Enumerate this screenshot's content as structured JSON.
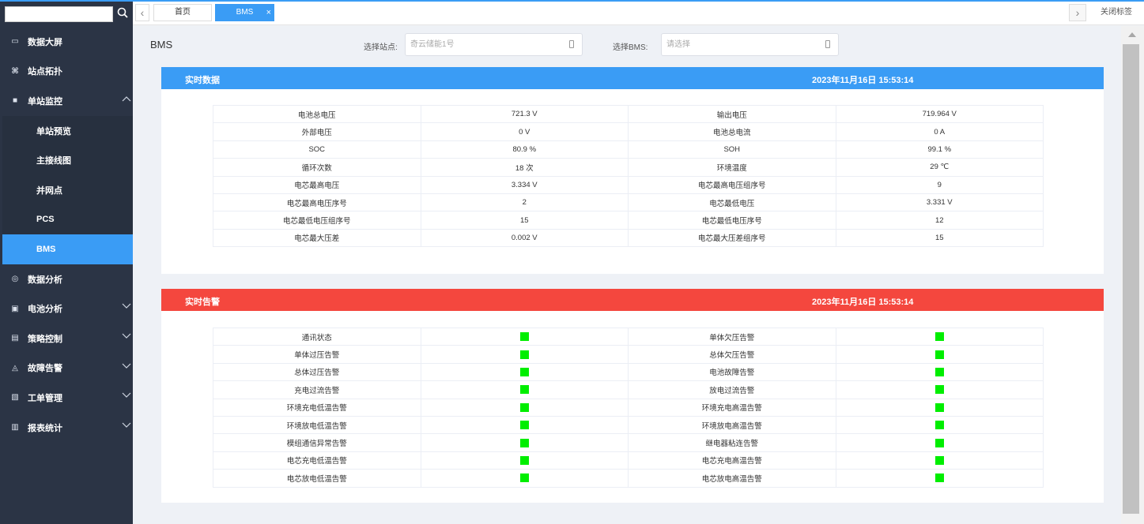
{
  "sidebar": {
    "search": {
      "value": "",
      "placeholder": ""
    },
    "menu": [
      {
        "label": "数据大屏",
        "icon": "monitor-icon"
      },
      {
        "label": "站点拓扑",
        "icon": "topology-icon"
      },
      {
        "label": "单站监控",
        "icon": "monitor-station-icon",
        "expanded": true,
        "children": [
          {
            "label": "单站预览"
          },
          {
            "label": "主接线图"
          },
          {
            "label": "并网点"
          },
          {
            "label": "PCS"
          },
          {
            "label": "BMS",
            "active": true
          }
        ]
      },
      {
        "label": "数据分析",
        "icon": "analysis-icon"
      },
      {
        "label": "电池分析",
        "icon": "battery-icon"
      },
      {
        "label": "策略控制",
        "icon": "strategy-icon"
      },
      {
        "label": "故障告警",
        "icon": "alarm-icon"
      },
      {
        "label": "工单管理",
        "icon": "workorder-icon"
      },
      {
        "label": "报表统计",
        "icon": "report-icon"
      }
    ]
  },
  "tabs": {
    "home": "首页",
    "active": "BMS",
    "close_all": "关闭标签"
  },
  "page": {
    "title": "BMS",
    "station_label": "选择站点:",
    "station_value": "奇云储能1号",
    "bms_label": "选择BMS:",
    "bms_placeholder": "请选择"
  },
  "realtime": {
    "title": "实时数据",
    "time": "2023年11月16日 15:53:14",
    "rows": [
      [
        "电池总电压",
        "721.3 V",
        "输出电压",
        "719.964 V"
      ],
      [
        "外部电压",
        "0 V",
        "电池总电流",
        "0 A"
      ],
      [
        "SOC",
        "80.9 %",
        "SOH",
        "99.1 %"
      ],
      [
        "循环次数",
        "18 次",
        "环境温度",
        "29 ℃"
      ],
      [
        "电芯最高电压",
        "3.334 V",
        "电芯最高电压组序号",
        "9"
      ],
      [
        "电芯最高电压序号",
        "2",
        "电芯最低电压",
        "3.331 V"
      ],
      [
        "电芯最低电压组序号",
        "15",
        "电芯最低电压序号",
        "12"
      ],
      [
        "电芯最大压差",
        "0.002 V",
        "电芯最大压差组序号",
        "15"
      ]
    ]
  },
  "alarm": {
    "title": "实时告警",
    "time": "2023年11月16日 15:53:14",
    "status_color": "#00ee00",
    "rows": [
      [
        "通讯状态",
        "单体欠压告警"
      ],
      [
        "单体过压告警",
        "总体欠压告警"
      ],
      [
        "总体过压告警",
        "电池故障告警"
      ],
      [
        "充电过流告警",
        "放电过流告警"
      ],
      [
        "环境充电低温告警",
        "环境充电高温告警"
      ],
      [
        "环境放电低温告警",
        "环境放电高温告警"
      ],
      [
        "模组通信异常告警",
        "继电器粘连告警"
      ],
      [
        "电芯充电低温告警",
        "电芯充电高温告警"
      ],
      [
        "电芯放电低温告警",
        "电芯放电高温告警"
      ]
    ]
  },
  "colors": {
    "sidebar_bg": "#2b3445",
    "accent": "#3a9cf5",
    "alarm_header": "#f4473e",
    "status_ok": "#00ee00"
  }
}
